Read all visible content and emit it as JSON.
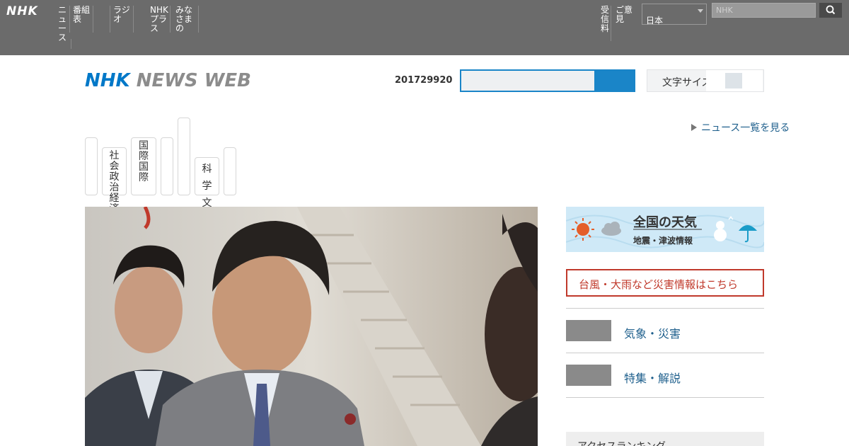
{
  "topbar": {
    "logo": "NHK",
    "global_nav": [
      "ニュース",
      "番組表",
      "",
      "ラジオ",
      "NHKプラス",
      "みなさまの"
    ],
    "utility_links": [
      "受信料",
      "ご意見"
    ],
    "language_select": "日本",
    "search_placeholder": "NHK",
    "search_icon": "search-icon"
  },
  "header": {
    "brand_nhk": "NHK",
    "brand_newsweb": "NEWS WEB",
    "date": "201729920",
    "site_search_placeholder": "",
    "text_size_label": "文字サイズ"
  },
  "categories": [
    {
      "label": ""
    },
    {
      "label": "社会政治経済"
    },
    {
      "label": "国際国際"
    },
    {
      "label": ""
    },
    {
      "label": ""
    },
    {
      "label": "科学文化"
    },
    {
      "label": ""
    }
  ],
  "more_link": "ニュース一覧を見る",
  "hero": {
    "image_desc": "news-photo"
  },
  "sidebar": {
    "weather_title": "全国の天気",
    "weather_sub": "地震・津波情報",
    "alert": "台風・大雨など災害情報はこちら",
    "links": [
      {
        "label": "気象・災害"
      },
      {
        "label": "特集・解説"
      }
    ],
    "ranking_title": "アクセスランキング"
  },
  "colors": {
    "topbar_bg": "#6b6b6b",
    "brand_blue": "#0078c8",
    "link_blue": "#1e5f8c",
    "alert_red": "#c0392b"
  }
}
